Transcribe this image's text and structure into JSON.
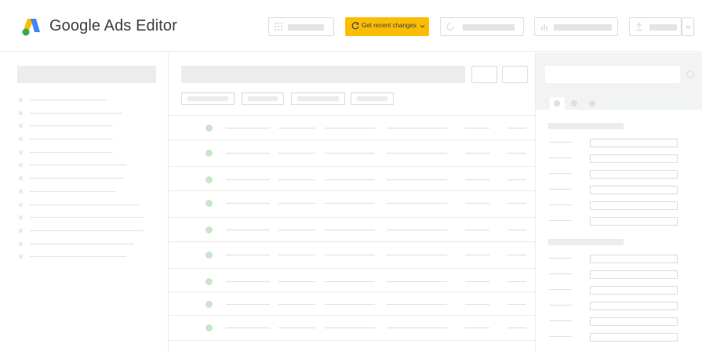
{
  "app": {
    "title": "Google Ads Editor",
    "brand_colors": {
      "blue": "#4285f4",
      "yellow": "#fbbc04",
      "green": "#34a853"
    }
  },
  "toolbar": {
    "get_recent_changes_label": "Get recent changes",
    "buttons": [
      {
        "icon": "grid-icon"
      },
      {
        "icon": "refresh-icon"
      },
      {
        "icon": "bar-chart-icon"
      },
      {
        "icon": "upload-icon"
      },
      {
        "icon": "chevron-down-icon"
      }
    ]
  },
  "status_colors": {
    "enabled_dot": "#c8e6c9"
  }
}
